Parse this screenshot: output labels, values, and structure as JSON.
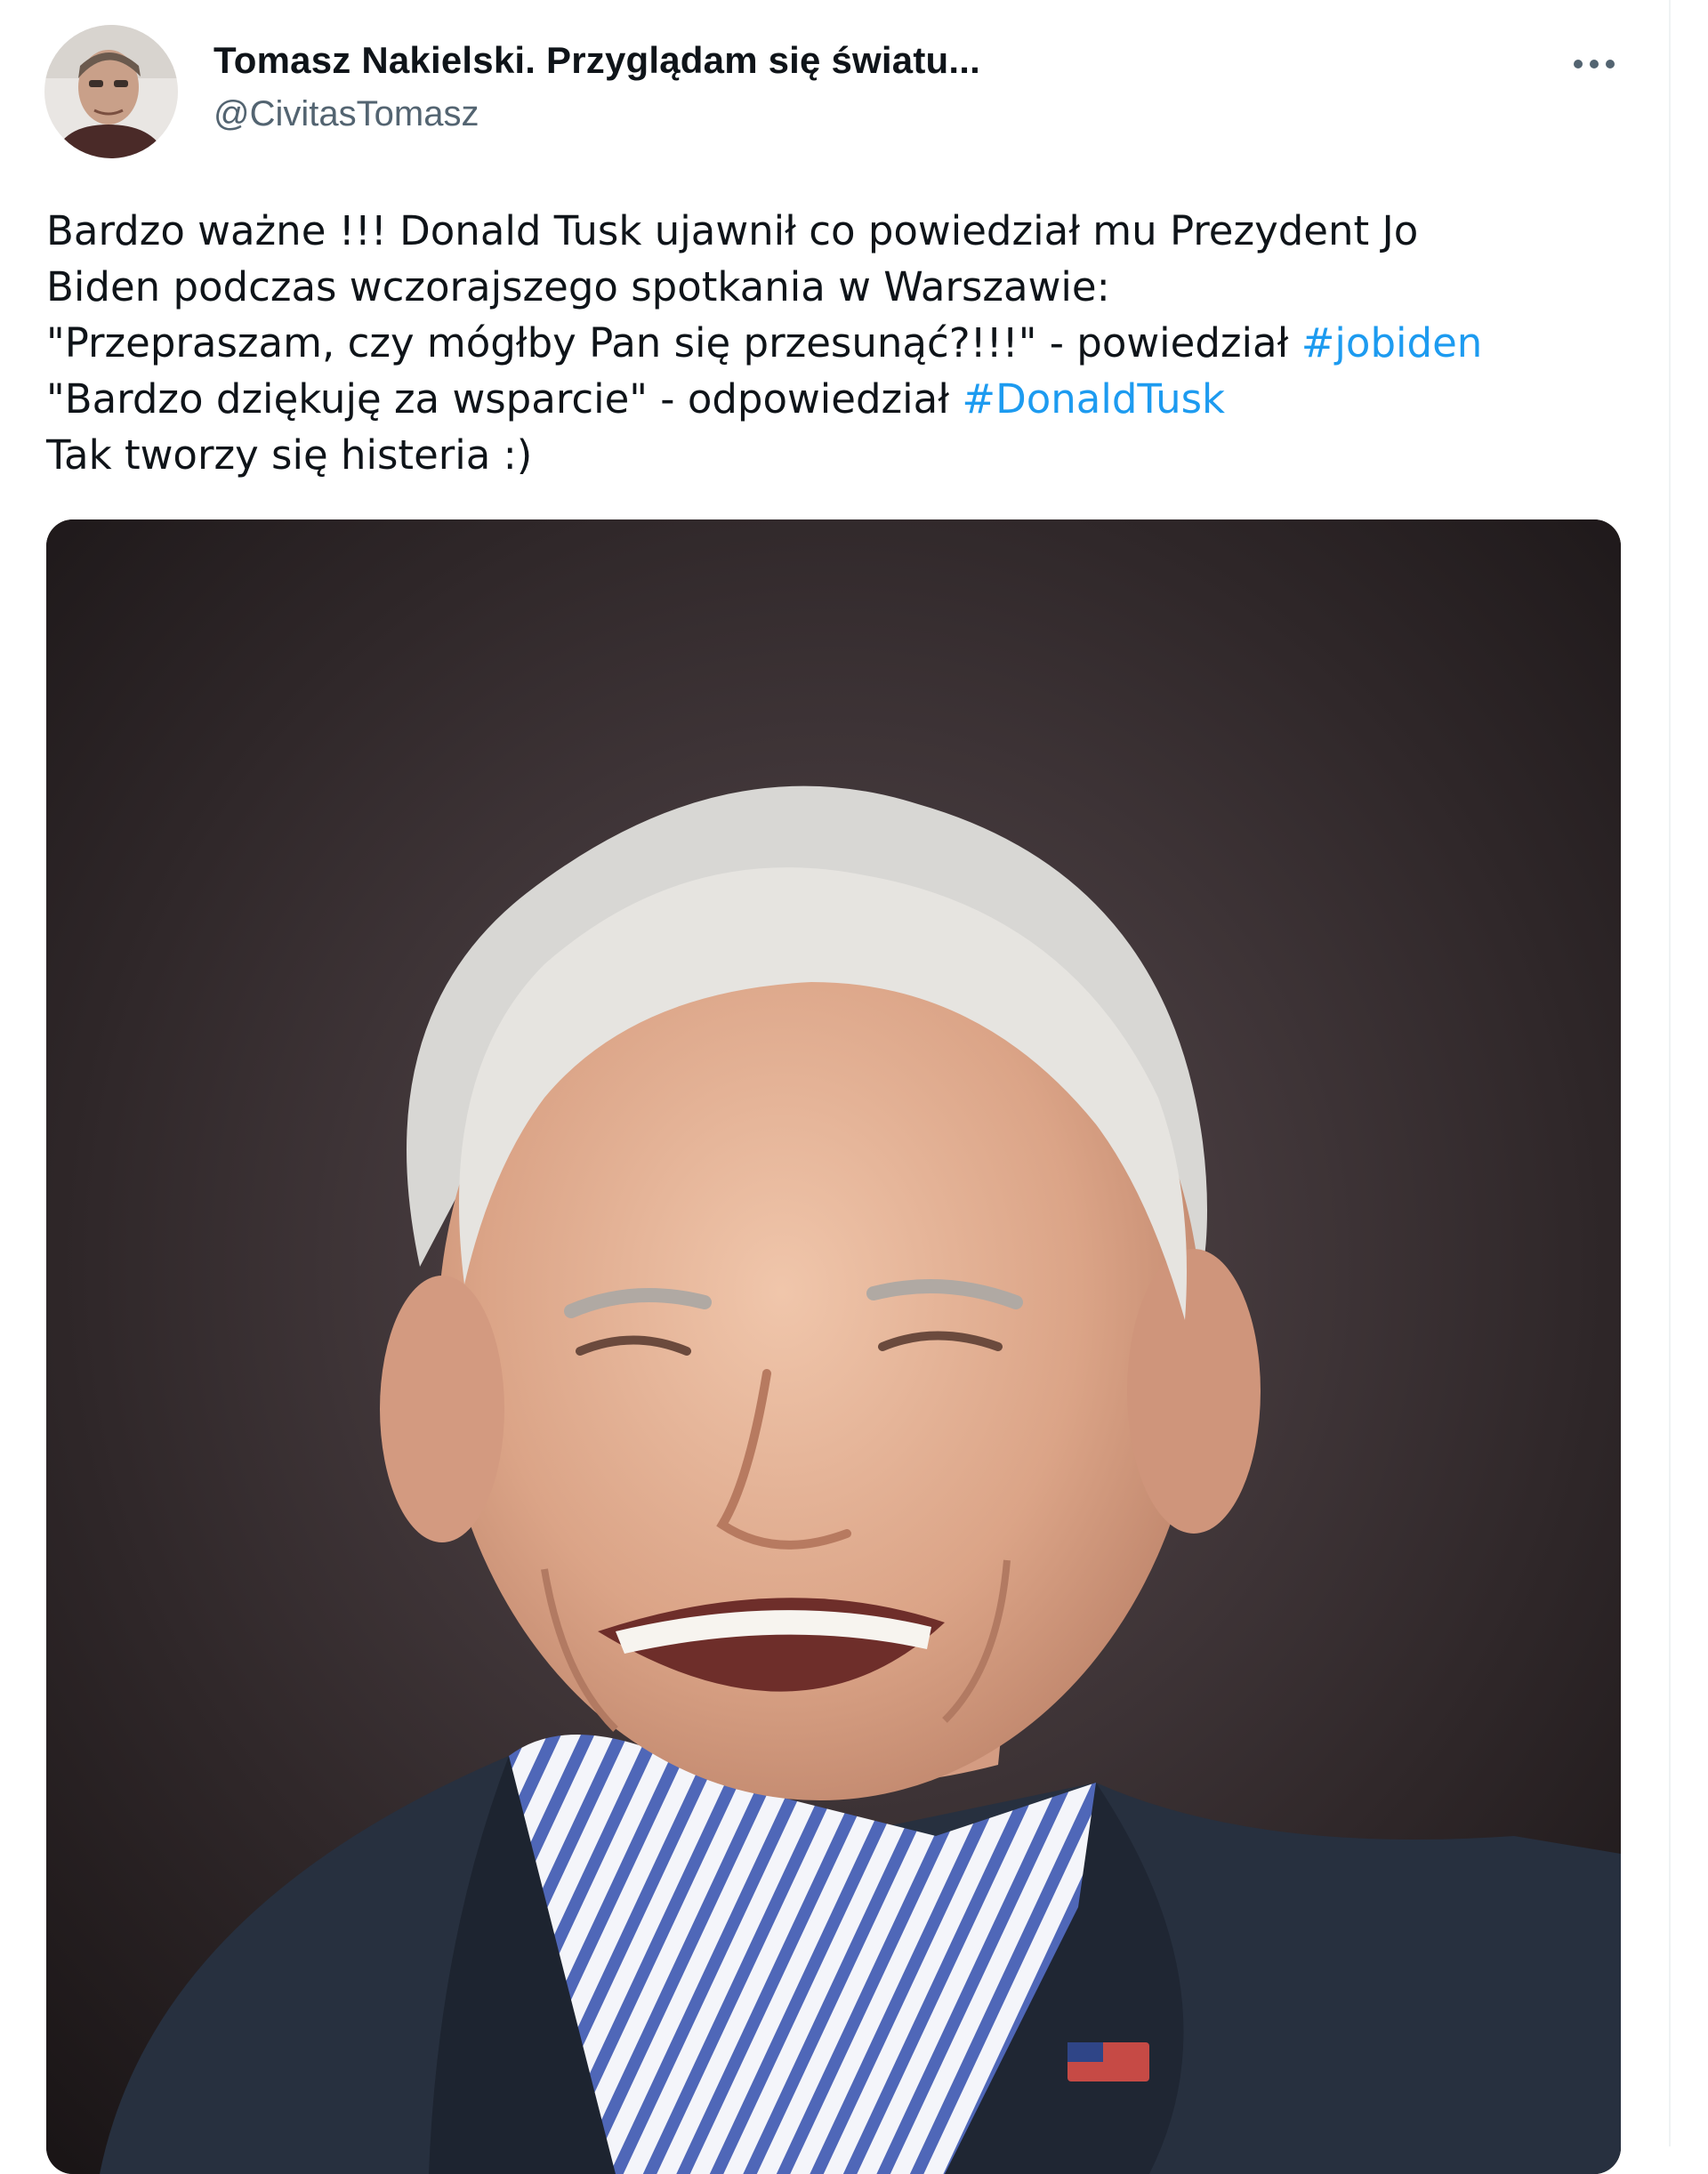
{
  "author": {
    "display_name": "Tomasz Nakielski. Przyglądam się światu...",
    "handle": "@CivitasTomasz",
    "avatar_icon": "user-avatar-photo"
  },
  "actions": {
    "more_icon": "more-dots-icon"
  },
  "tweet": {
    "line1": "Bardzo ważne !!! Donald Tusk ujawnił co powiedział mu Prezydent Jo",
    "line2": "Biden podczas wczorajszego spotkania w Warszawie:",
    "line3_text": "\"Przepraszam, czy mógłby Pan się przesunąć?!!!\" - powiedział ",
    "line3_hashtag": "#jobiden",
    "line4_text": "\"Bardzo dziękuję za wsparcie\" - odpowiedział ",
    "line4_hashtag": "#DonaldTusk",
    "line5": "Tak tworzy się histeria :)"
  },
  "media": {
    "kind": "photo",
    "subject": "smiling-man-portrait"
  },
  "colors": {
    "text": "#0f1419",
    "secondary": "#536471",
    "link": "#1d9bf0"
  }
}
